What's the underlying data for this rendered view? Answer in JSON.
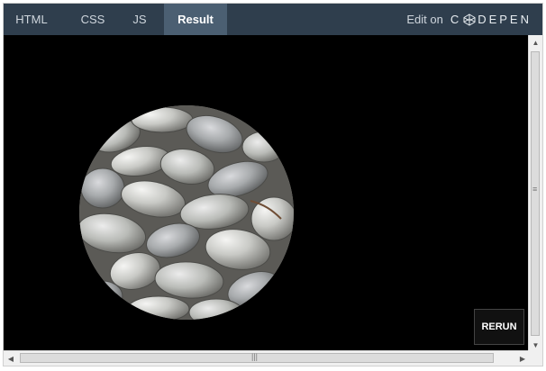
{
  "tabs": {
    "html": "HTML",
    "css": "CSS",
    "js": "JS",
    "result": "Result"
  },
  "header": {
    "edit_on": "Edit on",
    "brand": "CODEPEN"
  },
  "actions": {
    "rerun": "RERUN"
  },
  "image": {
    "alt": "circular image of gray stones"
  }
}
